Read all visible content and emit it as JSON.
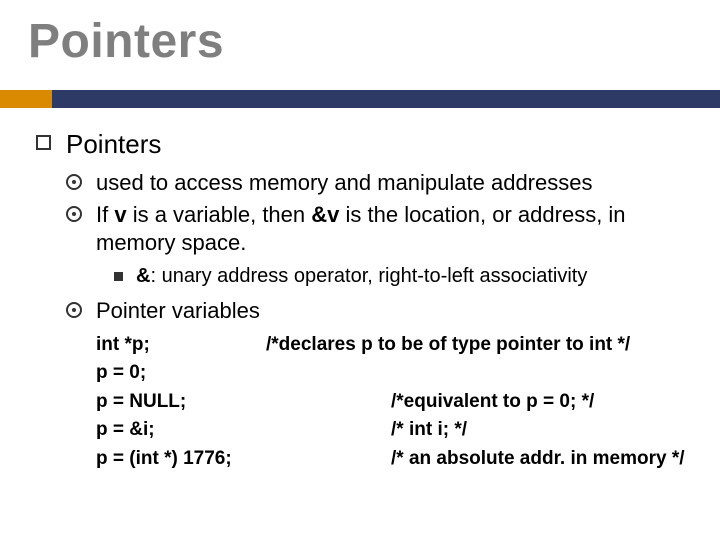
{
  "title": "Pointers",
  "lvl1": {
    "heading": "Pointers"
  },
  "lvl2": {
    "a": "used to access memory and manipulate addresses",
    "b_pre": "If ",
    "b_v": "v",
    "b_mid": " is a variable, then ",
    "b_amp_v": "&v",
    "b_post": " is the location, or address, in memory space.",
    "c": "Pointer variables"
  },
  "lvl3": {
    "a_bold": "&",
    "a_rest": ": unary address operator, right-to-left associativity"
  },
  "code": {
    "r1_l": "int *p;",
    "r1_r": "/*declares p to be of type pointer to int */",
    "r2_l": "p = 0;",
    "r2_r": "",
    "r3_l": "p = NULL;",
    "r3_r": "/*equivalent to p = 0; */",
    "r4_l": "p = &i;",
    "r4_r": "/* int i; */",
    "r5_l": "p = (int *) 1776;",
    "r5_r": "/* an absolute addr. in memory */"
  }
}
